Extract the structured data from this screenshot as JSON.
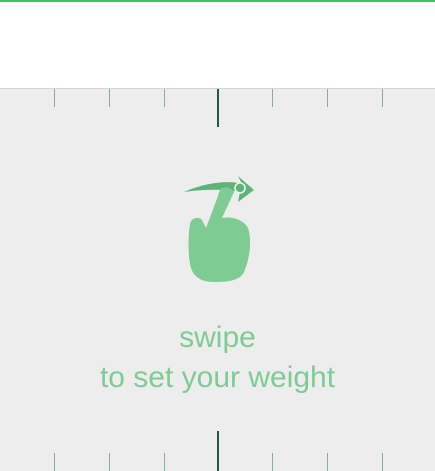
{
  "colors": {
    "accent": "#7fcb94",
    "accent_dark": "#5fb27a",
    "tick_minor": "#79b79a",
    "tick_major": "#1f5a48",
    "top_line": "#45c266",
    "background": "#ededed",
    "header": "#ffffff"
  },
  "hint": {
    "line1": "swipe",
    "line2": "to set your weight"
  },
  "icons": {
    "gesture": "swipe-hand-icon"
  }
}
